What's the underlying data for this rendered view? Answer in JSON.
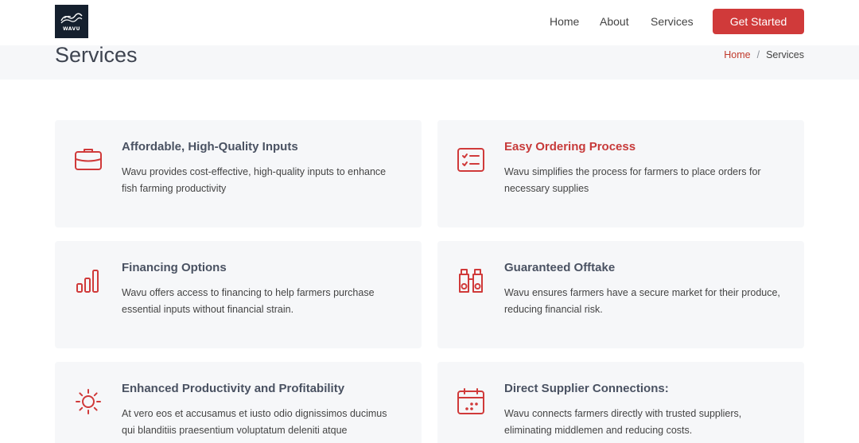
{
  "header": {
    "logo_text": "WAVU",
    "nav": [
      {
        "label": "Home"
      },
      {
        "label": "About"
      },
      {
        "label": "Services"
      }
    ],
    "cta_label": "Get Started"
  },
  "title_band": {
    "title": "Services",
    "breadcrumb": {
      "home": "Home",
      "separator": "/",
      "current": "Services"
    }
  },
  "colors": {
    "accent": "#d03a3a",
    "heading": "#4a5262",
    "card_bg": "#f6f7f9",
    "logo_bg": "#15202e"
  },
  "services": [
    {
      "icon": "briefcase-icon",
      "title": "Affordable, High-Quality Inputs",
      "description": "Wavu provides cost-effective, high-quality inputs to enhance fish farming productivity",
      "active": false
    },
    {
      "icon": "checklist-icon",
      "title": "Easy Ordering Process",
      "description": "Wavu simplifies the process for farmers to place orders for necessary supplies",
      "active": true
    },
    {
      "icon": "bar-chart-icon",
      "title": "Financing Options",
      "description": "Wavu offers access to financing to help farmers purchase essential inputs without financial strain.",
      "active": false
    },
    {
      "icon": "binoculars-icon",
      "title": "Guaranteed Offtake",
      "description": "Wavu ensures farmers have a secure market for their produce, reducing financial risk.",
      "active": false
    },
    {
      "icon": "sun-icon",
      "title": "Enhanced Productivity and Profitability",
      "description": "At vero eos et accusamus et iusto odio dignissimos ducimus qui blanditiis praesentium voluptatum deleniti atque",
      "active": false
    },
    {
      "icon": "calendar-icon",
      "title": "Direct Supplier Connections:",
      "description": "Wavu connects farmers directly with trusted suppliers, eliminating middlemen and reducing costs.",
      "active": false
    }
  ]
}
